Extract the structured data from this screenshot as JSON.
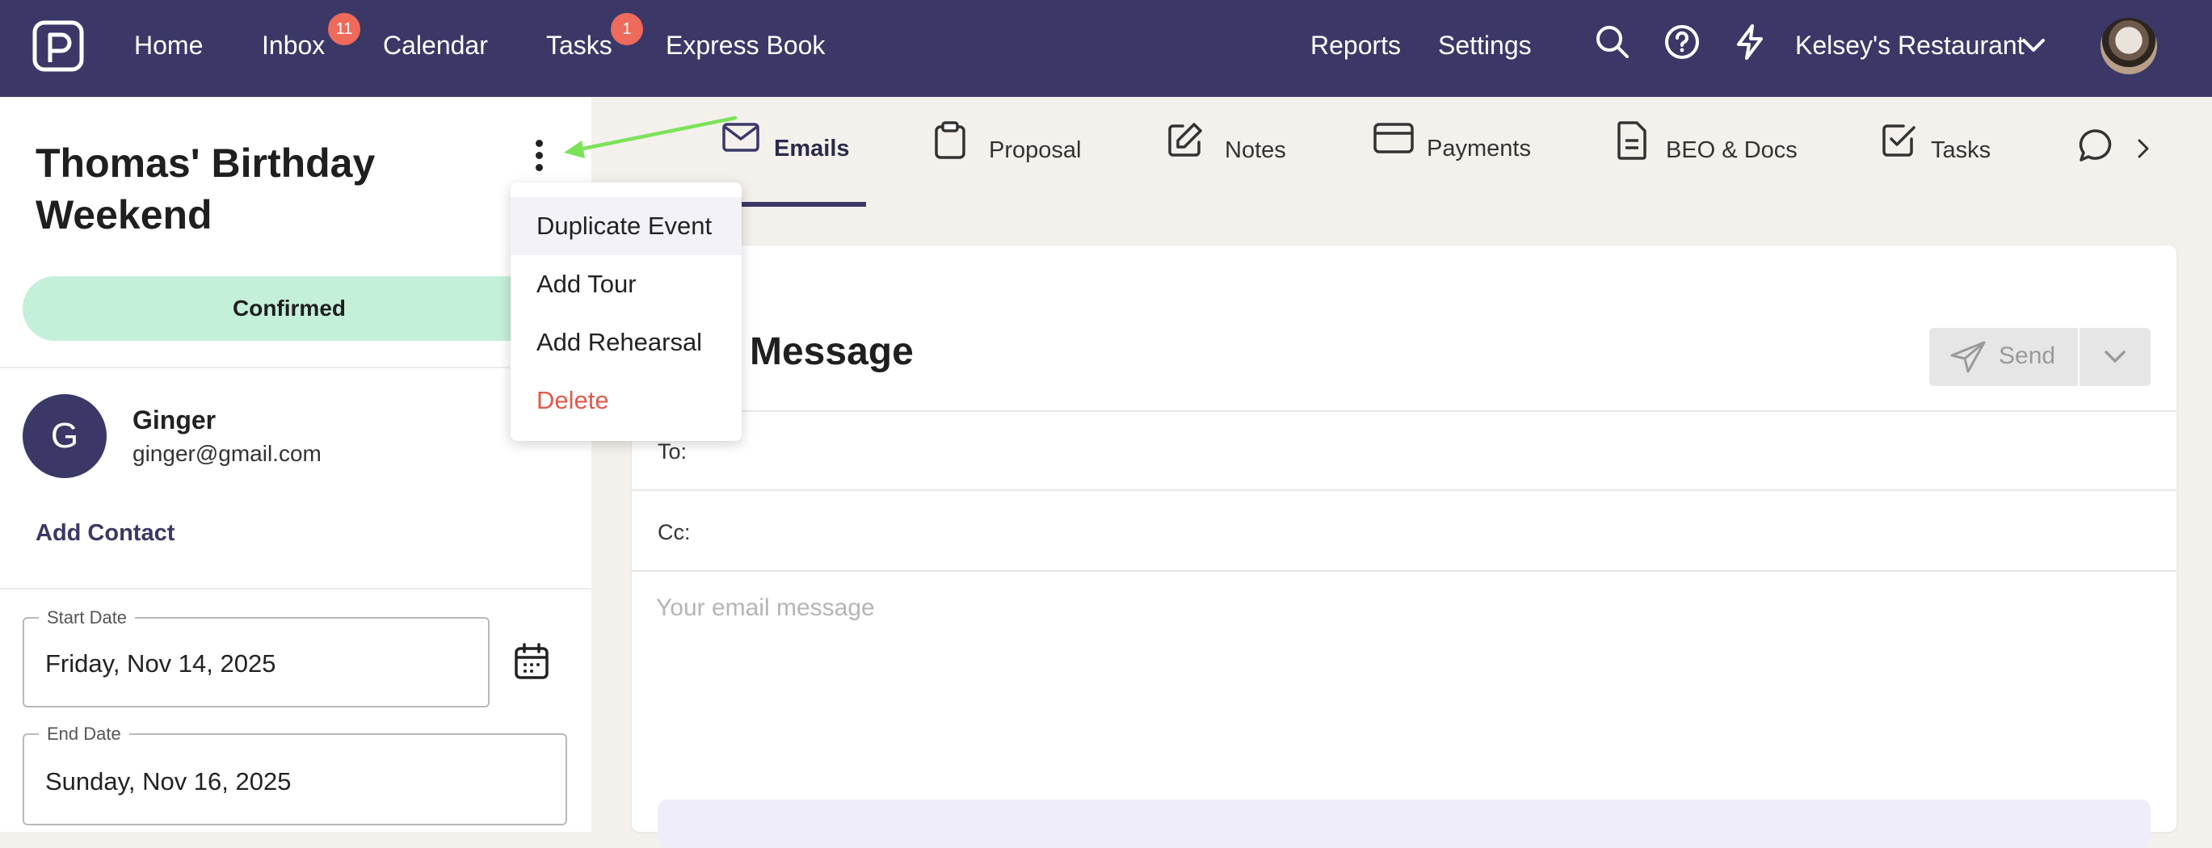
{
  "nav": {
    "home": "Home",
    "inbox": "Inbox",
    "inbox_badge": "11",
    "calendar": "Calendar",
    "tasks": "Tasks",
    "tasks_badge": "1",
    "express_book": "Express Book",
    "reports": "Reports",
    "settings": "Settings",
    "venue": "Kelsey's Restaurant",
    "icons": [
      "search-icon",
      "help-icon",
      "lightning-icon",
      "chevron-down-icon"
    ]
  },
  "event": {
    "title": "Thomas' Birthday Weekend",
    "status": "Confirmed",
    "status_color": "#c4efd9"
  },
  "contact": {
    "initial": "G",
    "name": "Ginger",
    "email": "ginger@gmail.com",
    "add_label": "Add Contact"
  },
  "dates": {
    "start_label": "Start Date",
    "start_value": "Friday, Nov 14, 2025",
    "end_label": "End Date",
    "end_value": "Sunday, Nov 16, 2025"
  },
  "tabs": [
    {
      "label": "Emails",
      "icon": "mail-icon",
      "active": true
    },
    {
      "label": "Proposal",
      "icon": "clipboard-icon"
    },
    {
      "label": "Notes",
      "icon": "edit-icon"
    },
    {
      "label": "Payments",
      "icon": "card-icon"
    },
    {
      "label": "BEO & Docs",
      "icon": "document-icon"
    },
    {
      "label": "Tasks",
      "icon": "checkbox-icon"
    }
  ],
  "composer": {
    "title": "Message",
    "send_label": "Send",
    "to_label": "To:",
    "cc_label": "Cc:",
    "message_placeholder": "Your email message"
  },
  "menu": {
    "items": [
      {
        "label": "Duplicate Event"
      },
      {
        "label": "Add Tour"
      },
      {
        "label": "Add Rehearsal"
      },
      {
        "label": "Delete",
        "color": "#e0594b"
      }
    ]
  },
  "colors": {
    "brand": "#3b3868",
    "badge": "#ee6a5a",
    "annotation_arrow": "#7be35a"
  }
}
